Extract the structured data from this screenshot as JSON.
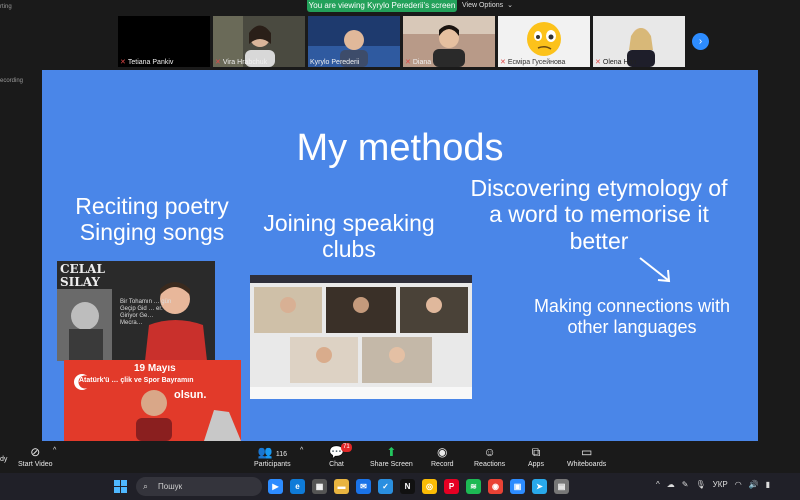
{
  "topbar": {
    "sharing_banner": "You are viewing Kyrylo Perederii's screen",
    "view_options": "View Options",
    "left_labels": [
      "rting",
      "ecording"
    ]
  },
  "participants": [
    {
      "name": "Tetiana Pankiv",
      "muted": true
    },
    {
      "name": "Vira Hrabchuk",
      "muted": true
    },
    {
      "name": "Kyrylo Perederii",
      "muted": false
    },
    {
      "name": "Diana",
      "muted": true
    },
    {
      "name": "Есміра Гусейнова",
      "muted": true
    },
    {
      "name": "Olena Han",
      "muted": true
    }
  ],
  "slide": {
    "title": "My methods",
    "col1": "Reciting poetry\nSinging songs",
    "col2": "Joining speaking\nclubs",
    "col3": "Discovering etymology of\na word to memorise it\nbetter",
    "col4": "Making connections with\nother languages",
    "celal_image": {
      "heading": "CELAL\nSILAY",
      "caption": "Bir Tohamın … gün\nGeçip Gid … er.\nGiriyor Ge…\nMecra…"
    },
    "may_image": {
      "date": "19 Mayıs",
      "subtitle": "Atatürk'ü … çlik ve Spor Bayramın",
      "tail": "olsun."
    }
  },
  "controls": {
    "start_video": "Start Video",
    "participants": "Participants",
    "participants_count": "116",
    "chat": "Chat",
    "chat_badge": "71",
    "share_screen": "Share Screen",
    "record": "Record",
    "reactions": "Reactions",
    "apps": "Apps",
    "whiteboards": "Whiteboards",
    "left_edge": "dy"
  },
  "taskbar": {
    "search_placeholder": "Пошук",
    "language": "УКР"
  },
  "colors": {
    "slide_bg": "#4a86e8",
    "share_green": "#23a15a",
    "zoom_blue": "#2d8cff",
    "alert_red": "#e02828"
  }
}
